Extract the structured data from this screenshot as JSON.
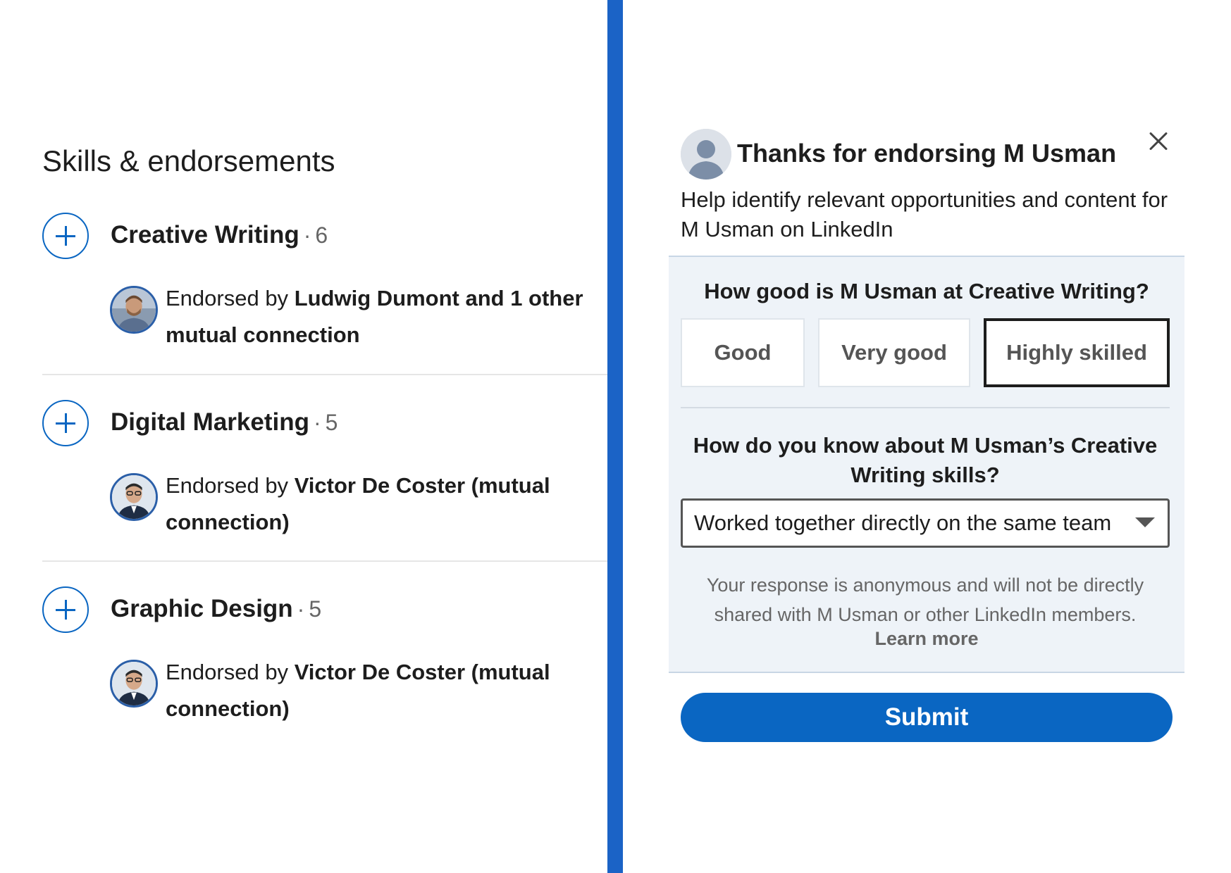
{
  "skills_panel": {
    "title": "Skills & endorsements",
    "skills": [
      {
        "name": "Creative Writing",
        "separator": "·",
        "count": "6",
        "endorsed_prefix": "Endorsed by",
        "endorsers": "Ludwig Dumont and 1 other mutual connection"
      },
      {
        "name": "Digital Marketing",
        "separator": "·",
        "count": "5",
        "endorsed_prefix": "Endorsed by",
        "endorsers": "Victor De Coster (mutual connection)"
      },
      {
        "name": "Graphic Design",
        "separator": "·",
        "count": "5",
        "endorsed_prefix": "Endorsed by",
        "endorsers": "Victor De Coster (mutual connection)"
      }
    ]
  },
  "endorse_modal": {
    "title": "Thanks for endorsing M Usman",
    "subtitle": "Help identify relevant opportunities and content for M Usman on LinkedIn",
    "question_level": "How good is M Usman at Creative Writing?",
    "level_options": [
      "Good",
      "Very good",
      "Highly skilled"
    ],
    "selected_level": "Highly skilled",
    "question_relationship": "How do you know about M Usman’s Creative Writing skills?",
    "relationship_value": "Worked together directly on the same team",
    "note": "Your response is anonymous and will not be directly shared with M Usman or other LinkedIn members.",
    "learn_more": "Learn more",
    "submit_label": "Submit"
  },
  "colors": {
    "accent": "#0a66c2",
    "separator": "#1b63c6",
    "modal_body_bg": "#eef3f8"
  },
  "icons": {
    "add_skill": "plus-circle-icon",
    "close": "close-icon",
    "dropdown": "caret-down-icon"
  }
}
